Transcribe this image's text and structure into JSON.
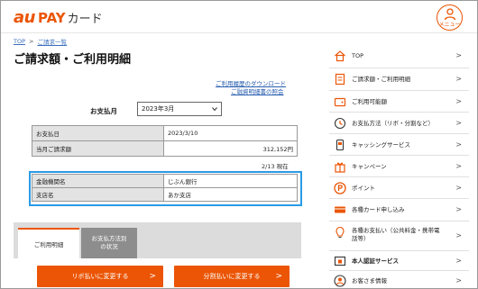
{
  "header": {
    "logo_au": "au",
    "logo_pay": "PAY",
    "logo_card": "カード",
    "menu_label": "メニュー"
  },
  "breadcrumb": {
    "top": "TOP",
    "separator": ">",
    "current": "ご請求一覧"
  },
  "page_title": "ご請求額・ご利用明細",
  "links": {
    "download": "ご利用履歴のダウンロード",
    "inquiry": "ご融資明細書の照会"
  },
  "pay_month": {
    "label": "お支払月",
    "selected": "2023年3月"
  },
  "summary": [
    {
      "label": "お支払日",
      "value": "2023/3/10"
    },
    {
      "label": "当月ご請求額",
      "value": "312,152円"
    }
  ],
  "page_count": "2/13 現在",
  "bank": [
    {
      "label": "金融機関名",
      "value": "じぶん銀行"
    },
    {
      "label": "支店名",
      "value": "あか支店"
    }
  ],
  "tabs": {
    "active": "ご利用明細",
    "inactive_line1": "お支払方法別",
    "inactive_line2": "の状況"
  },
  "buttons": {
    "revolving": "リボ払いに変更する",
    "installment": "分割払いに変更する",
    "arrow": ">"
  },
  "sidebar": {
    "chevron": ">",
    "items": [
      {
        "label": "TOP",
        "icon": "home-icon"
      },
      {
        "label": "ご請求額・ご利用明細",
        "icon": "statement-icon"
      },
      {
        "label": "ご利用可能額",
        "icon": "wallet-icon"
      },
      {
        "label": "お支払方法（リボ・分割など）",
        "icon": "payment-method-icon"
      },
      {
        "label": "キャッシングサービス",
        "icon": "cash-icon"
      },
      {
        "label": "キャンペーン",
        "icon": "gift-icon"
      },
      {
        "label": "ポイント",
        "icon": "point-icon"
      },
      {
        "label": "各種カード申し込み",
        "icon": "card-apply-icon"
      },
      {
        "label": "各種お支払い（公共料金・携帯電",
        "label2": "話等）",
        "icon": "bill-payment-icon"
      },
      {
        "label": "本人認証サービス",
        "icon": "auth-icon"
      },
      {
        "label": "お客さま情報",
        "icon": "customer-info-icon"
      }
    ]
  },
  "colors": {
    "brand": "#eb5505",
    "link": "#2a5fb0",
    "highlight": "#2a9ae6"
  }
}
